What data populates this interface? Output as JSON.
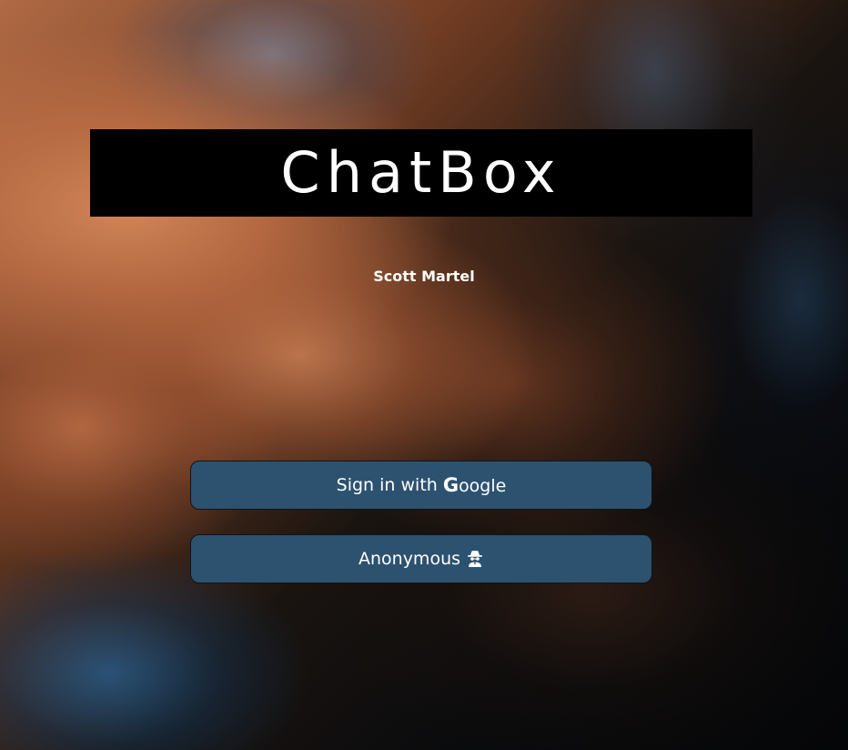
{
  "app": {
    "title": "ChatBox",
    "author": "Scott Martel"
  },
  "buttons": {
    "google": {
      "prefix": "Sign in with",
      "g_letter": "G",
      "suffix": "oogle",
      "icon": "google-g-icon"
    },
    "anonymous": {
      "label": "Anonymous",
      "icon": "incognito-spy-icon"
    }
  },
  "colors": {
    "button_bg": "#2c5270",
    "banner_bg": "#000000",
    "text": "#ffffff"
  }
}
